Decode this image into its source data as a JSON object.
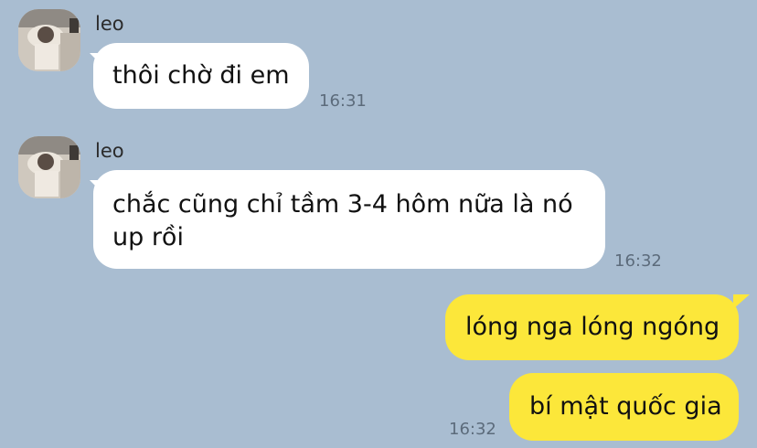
{
  "messages": [
    {
      "sender": "leo",
      "text": "thôi chờ đi em",
      "time": "16:31"
    },
    {
      "sender": "leo",
      "text": "chắc cũng chỉ tầm 3-4 hôm nữa là nó\nup rồi",
      "time": "16:32"
    },
    {
      "text": "lóng nga lóng ngóng"
    },
    {
      "text": "bí mật quốc gia",
      "time": "16:32"
    }
  ],
  "colors": {
    "background": "#a9bdd1",
    "incoming_bubble": "#ffffff",
    "outgoing_bubble": "#fce73a"
  }
}
